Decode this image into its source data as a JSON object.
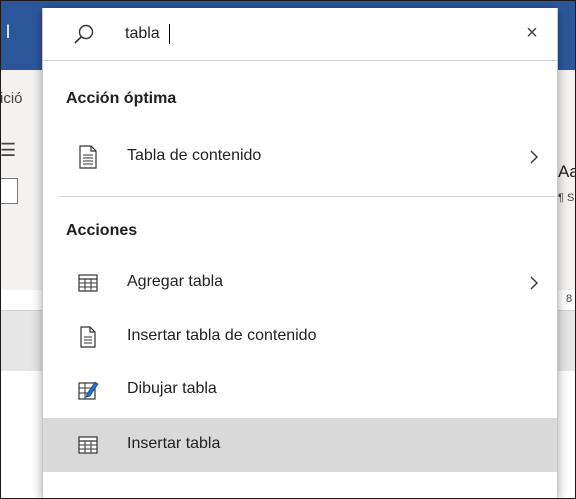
{
  "background": {
    "title_char": "l",
    "ribbon_fragment_left": "ició",
    "ribbon_fragment_right_1": "Aa",
    "ribbon_fragment_right_2": "¶ S",
    "ruler_mark": "8"
  },
  "search": {
    "value": "tabla",
    "close_glyph": "×"
  },
  "sections": {
    "best": {
      "title": "Acción óptima"
    },
    "actions": {
      "title": "Acciones"
    }
  },
  "items": {
    "toc": {
      "label": "Tabla de contenido"
    },
    "add_table": {
      "label": "Agregar tabla"
    },
    "insert_toc": {
      "label": "Insertar tabla de contenido"
    },
    "draw_table": {
      "label": "Dibujar tabla"
    },
    "insert_table": {
      "label": "Insertar tabla"
    }
  },
  "colors": {
    "titlebar": "#2b579a",
    "selected_row": "#d9d9d9",
    "pencil_blue": "#2b6cc4"
  }
}
